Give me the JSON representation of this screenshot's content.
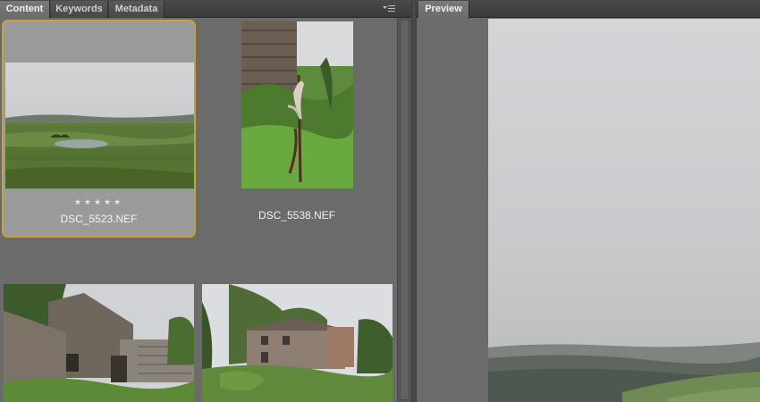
{
  "tabs": {
    "content": "Content",
    "keywords": "Keywords",
    "metadata": "Metadata"
  },
  "preview_tab": "Preview",
  "thumbnails": [
    {
      "filename": "DSC_5523.NEF",
      "rating": "★★★★★",
      "selected": true
    },
    {
      "filename": "DSC_5538.NEF",
      "selected": false
    },
    {
      "filename": "",
      "selected": false
    },
    {
      "filename": "",
      "selected": false
    }
  ],
  "colors": {
    "panel_bg": "#6b6b6b",
    "selection_border": "#c7a23c",
    "selection_fill": "#9a9a9a"
  },
  "icons": {
    "panel_menu": "panel-menu-icon"
  }
}
